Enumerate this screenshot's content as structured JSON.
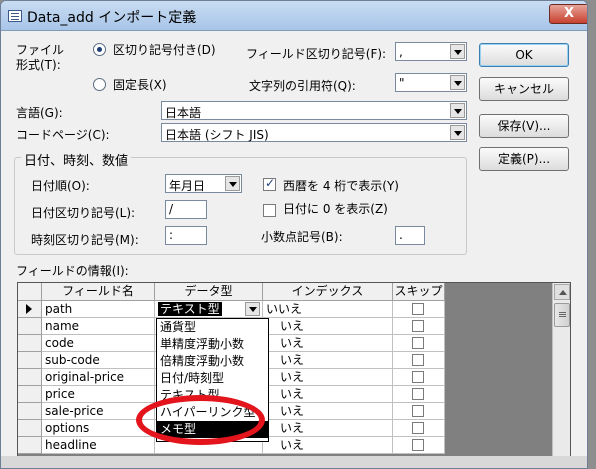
{
  "window": {
    "title": "Data_add インポート定義",
    "close_glyph": "X"
  },
  "file_format": {
    "label_line1": "ファイル",
    "label_line2": "形式(T):",
    "delimited_label": "区切り記号付き(D)",
    "delimited_selected": true,
    "fixed_label": "固定長(X)",
    "field_delim_label": "フィールド区切り記号(F):",
    "field_delim_value": ",",
    "text_qualifier_label": "文字列の引用符(Q):",
    "text_qualifier_value": "\""
  },
  "language": {
    "label": "言語(G):",
    "value": "日本語"
  },
  "codepage": {
    "label": "コードページ(C):",
    "value": "日本語 (シフト JIS)"
  },
  "datetime": {
    "group_label": "日付、時刻、数値",
    "date_order_label": "日付順(O):",
    "date_order_value": "年月日",
    "date_delim_label": "日付区切り記号(L):",
    "date_delim_value": "/",
    "time_delim_label": "時刻区切り記号(M):",
    "time_delim_value": ":",
    "four_digit_label": "西暦を 4 桁で表示(Y)",
    "four_digit_checked": true,
    "leading_zero_label": "日付に 0 を表示(Z)",
    "leading_zero_checked": false,
    "decimal_label": "小数点記号(B):",
    "decimal_value": "."
  },
  "buttons": {
    "ok": "OK",
    "cancel": "キャンセル",
    "save": "保存(V)...",
    "specs": "定義(P)..."
  },
  "fields_info": {
    "label": "フィールドの情報(I):",
    "headers": [
      "フィールド名",
      "データ型",
      "インデックス",
      "スキップ"
    ],
    "rows": [
      {
        "name": "path",
        "type": "テキスト型",
        "index": "いいえ"
      },
      {
        "name": "name",
        "type": "",
        "index": "いえ"
      },
      {
        "name": "code",
        "type": "",
        "index": "いえ"
      },
      {
        "name": "sub-code",
        "type": "",
        "index": "いえ"
      },
      {
        "name": "original-price",
        "type": "",
        "index": "いえ"
      },
      {
        "name": "price",
        "type": "",
        "index": "いえ"
      },
      {
        "name": "sale-price",
        "type": "",
        "index": "いえ"
      },
      {
        "name": "options",
        "type": "",
        "index": "いえ"
      },
      {
        "name": "headline",
        "type": "",
        "index": "いえ"
      }
    ]
  },
  "type_dropdown": {
    "options": [
      "通貨型",
      "単精度浮動小数",
      "倍精度浮動小数",
      "日付/時刻型",
      "テキスト型",
      "ハイパーリンク型",
      "メモ型"
    ],
    "highlighted": "メモ型"
  },
  "colors": {
    "annotation_ring": "#e3141b",
    "titlebar": "#b8d1ee"
  }
}
